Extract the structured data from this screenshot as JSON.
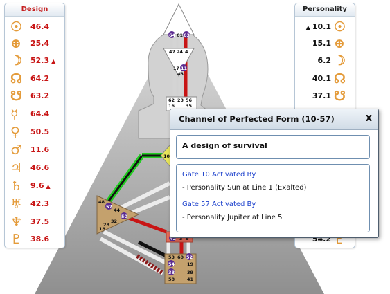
{
  "design_panel": {
    "title": "Design",
    "rows": [
      {
        "planet": "sun",
        "glyph": "☉",
        "value": "46.4",
        "marker": ""
      },
      {
        "planet": "earth",
        "glyph": "⊕",
        "value": "25.4",
        "marker": ""
      },
      {
        "planet": "moon",
        "glyph": "☽",
        "value": "52.3",
        "marker": "▲"
      },
      {
        "planet": "north-node",
        "glyph": "☊",
        "value": "64.2",
        "marker": ""
      },
      {
        "planet": "south-node",
        "glyph": "☋",
        "value": "63.2",
        "marker": ""
      },
      {
        "planet": "mercury",
        "glyph": "☿",
        "value": "64.4",
        "marker": ""
      },
      {
        "planet": "venus",
        "glyph": "♀",
        "value": "50.5",
        "marker": ""
      },
      {
        "planet": "mars",
        "glyph": "♂",
        "value": "11.6",
        "marker": ""
      },
      {
        "planet": "jupiter",
        "glyph": "♃",
        "value": "46.6",
        "marker": ""
      },
      {
        "planet": "saturn",
        "glyph": "♄",
        "value": "9.6",
        "marker": "▲"
      },
      {
        "planet": "uranus",
        "glyph": "♅",
        "value": "42.3",
        "marker": ""
      },
      {
        "planet": "neptune",
        "glyph": "♆",
        "value": "37.5",
        "marker": ""
      },
      {
        "planet": "pluto",
        "glyph": "♇",
        "value": "38.6",
        "marker": ""
      }
    ]
  },
  "personality_panel": {
    "title": "Personality",
    "rows": [
      {
        "planet": "sun",
        "glyph": "☉",
        "value": "10.1",
        "marker": "▲"
      },
      {
        "planet": "earth",
        "glyph": "⊕",
        "value": "15.1",
        "marker": ""
      },
      {
        "planet": "moon",
        "glyph": "☽",
        "value": "6.2",
        "marker": ""
      },
      {
        "planet": "north-node",
        "glyph": "☊",
        "value": "40.1",
        "marker": ""
      },
      {
        "planet": "south-node",
        "glyph": "☋",
        "value": "37.1",
        "marker": ""
      },
      {
        "planet": "mercury",
        "glyph": "",
        "value": "",
        "marker": ""
      },
      {
        "planet": "venus",
        "glyph": "",
        "value": "",
        "marker": ""
      },
      {
        "planet": "mars",
        "glyph": "",
        "value": "",
        "marker": ""
      },
      {
        "planet": "jupiter",
        "glyph": "",
        "value": "",
        "marker": ""
      },
      {
        "planet": "saturn",
        "glyph": "",
        "value": "",
        "marker": ""
      },
      {
        "planet": "uranus",
        "glyph": "",
        "value": "",
        "marker": ""
      },
      {
        "planet": "neptune",
        "glyph": "",
        "value": "",
        "marker": ""
      },
      {
        "planet": "pluto",
        "glyph": "♇",
        "value": "54.2",
        "marker": ""
      }
    ]
  },
  "popup": {
    "title": "Channel of Perfected Form (10-57)",
    "close": "X",
    "subtitle": "A design of survival",
    "gates": [
      {
        "title": "Gate 10 Activated By",
        "line": "- Personality Sun at Line 1 (Exalted)"
      },
      {
        "title": "Gate 57 Activated By",
        "line": "- Personality Jupiter at Line 5"
      }
    ]
  },
  "bodygraph": {
    "head_gates": [
      "64",
      "61",
      "63"
    ],
    "ajna_gates": [
      "47",
      "24",
      "4",
      "17",
      "11",
      "43"
    ],
    "throat_gates": [
      "62",
      "23",
      "56",
      "16",
      "35"
    ],
    "g_gates": [
      "10"
    ],
    "spleen_gates": [
      "48",
      "57",
      "44",
      "50",
      "32",
      "28",
      "18"
    ],
    "sacral_gates": [
      "42",
      "3",
      "9"
    ],
    "root_gates": [
      "53",
      "60",
      "52",
      "54",
      "19",
      "38",
      "39",
      "58",
      "41"
    ]
  },
  "colors": {
    "design": "#c81414",
    "personality": "#111111",
    "accent": "#e49b3a",
    "channel_active": "#22cc22"
  }
}
